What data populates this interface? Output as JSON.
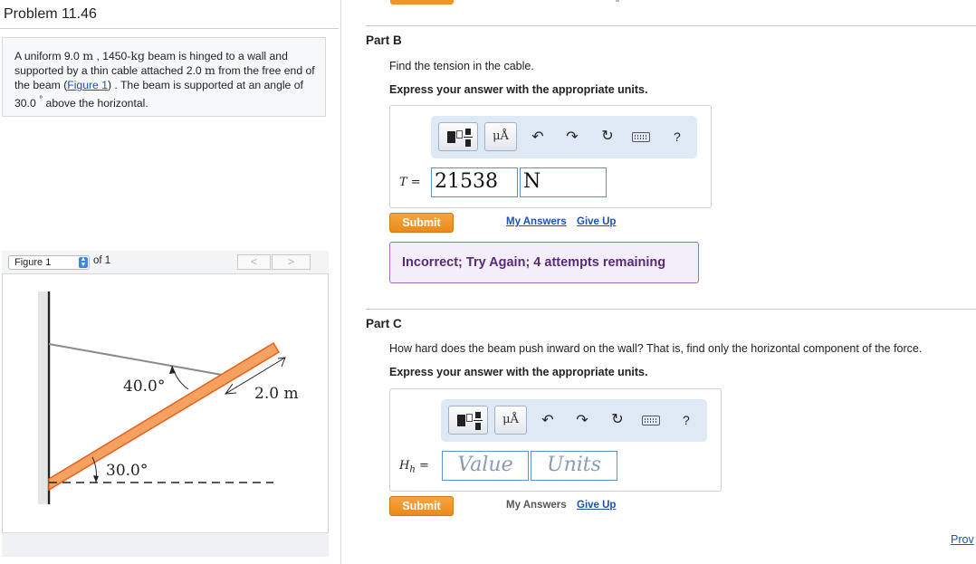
{
  "problem": {
    "title": "Problem 11.46",
    "statement": {
      "p1": "A uniform 9.0 ",
      "u1": "m",
      "p2": " , 1450-",
      "u2": "kg",
      "p3": " beam is hinged to a wall and supported by a thin cable attached 2.0 ",
      "u3": "m",
      "p4": " from the free end of the beam (",
      "figure_link": "Figure 1",
      "p5": ") . The beam is supported at an angle of 30.0 ",
      "degree": "°",
      "p6": " above the horizontal."
    }
  },
  "figure_panel": {
    "select_value": "Figure 1",
    "of_label": "of 1",
    "prev": "<",
    "next": ">",
    "labels": {
      "angle_cable": "40.0°",
      "distance": "2.0 m",
      "angle_beam": "30.0°"
    },
    "colors": {
      "beam_fill": "#f5a15f",
      "beam_edge": "#e5601e",
      "cable": "#8a8a8a",
      "wall": "#222222"
    }
  },
  "part_b": {
    "title": "Part B",
    "question": "Find the tension in the cable.",
    "instruction": "Express your answer with the appropriate units.",
    "toolbar": {
      "mu_label": "μÅ",
      "undo_icon": "undo-icon",
      "redo_icon": "redo-icon",
      "reset_icon": "reset-icon",
      "keyboard_icon": "keyboard-icon",
      "help_label": "?"
    },
    "var_label": "T =",
    "value": "21538",
    "units": "N",
    "submit": "Submit",
    "my_answers": "My Answers",
    "give_up": "Give Up",
    "feedback": "Incorrect; Try Again; 4 attempts remaining"
  },
  "part_c": {
    "title": "Part C",
    "question": "How hard does the beam push inward on the wall? That is, find only the horizontal component of the force.",
    "instruction": "Express your answer with the appropriate units.",
    "toolbar": {
      "mu_label": "μÅ",
      "help_label": "?"
    },
    "var_label": "H",
    "var_sub": "h",
    "var_eq": "=",
    "value_placeholder": "Value",
    "units_placeholder": "Units",
    "submit": "Submit",
    "my_answers": "My Answers",
    "give_up": "Give Up"
  },
  "footer": {
    "provide_link": "Prov"
  },
  "colors": {
    "link": "#1a52b3",
    "submit": "#f0952a",
    "feedback_border": "#a66bbf",
    "toolbar_bg": "#dfe8f5"
  }
}
